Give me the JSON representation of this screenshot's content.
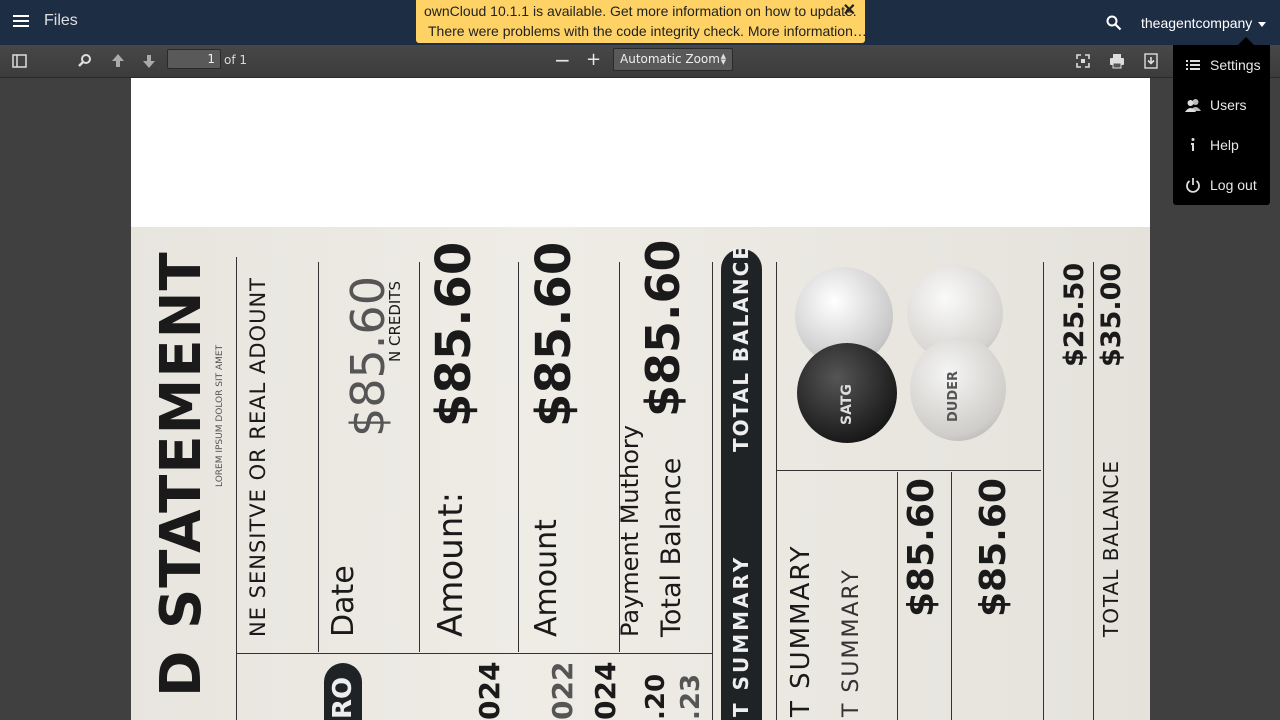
{
  "header": {
    "app_title": "Files",
    "notification": {
      "line1": "ownCloud 10.1.1 is available. Get more information on how to update.",
      "line2": "There were problems with the code integrity check. More information…",
      "close": "✕"
    },
    "user": "theagentcompany"
  },
  "toolbar": {
    "page_number": "1",
    "page_count_label": "of 1",
    "zoom_minus": "−",
    "zoom_plus": "+",
    "zoom_value": "Automatic Zoom"
  },
  "user_menu": {
    "items": [
      {
        "label": "Settings",
        "icon": "settings-list-icon"
      },
      {
        "label": "Users",
        "icon": "users-icon"
      },
      {
        "label": "Help",
        "icon": "info-icon"
      },
      {
        "label": "Log out",
        "icon": "power-icon"
      }
    ]
  },
  "document": {
    "title": "D STATEMENT",
    "subtitle": "NE SENSITVE OR REAL ADOUNT",
    "col_date": "Date",
    "col_amount": "Amount:",
    "col_amount2": "Amount",
    "col_payment": "Payment Muthory",
    "col_total": "Total Balance",
    "amount_1": "$85.60",
    "amount_2": "$85.60",
    "amount_3": "$85.60",
    "amount_4": "$85.60",
    "credits": "N CREDITS",
    "total_balance_bar": "TOTAL BALANCE",
    "summary_bar": "T SUMMARY",
    "summary_1": "T SUMMARY",
    "summary_2": "T SUMMARY",
    "amount_5": "$85.60",
    "amount_6": "$85.60",
    "side_amount_1": "$25.50",
    "side_amount_2": "$35.00",
    "total_balance_2": "TOTAL BALANCE",
    "ro_badge": "RO",
    "year_1": "024",
    "year_2": "022",
    "year_3": "024",
    "dec_1": ".20",
    "dec_2": ".23",
    "coin_label_1": "SATG",
    "coin_label_2": "DUDER"
  }
}
